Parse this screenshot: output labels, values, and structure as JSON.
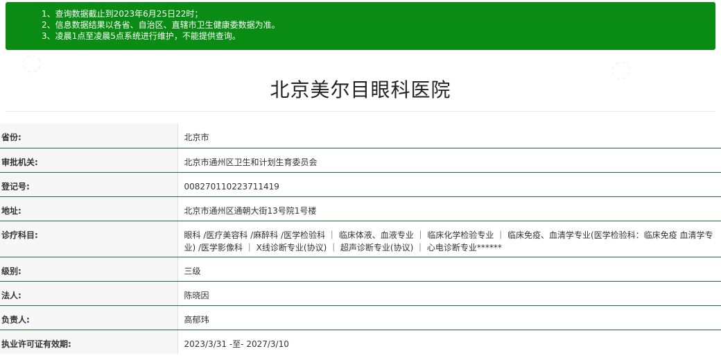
{
  "notice": {
    "lines": [
      "1、查询数据截止到2023年6月25日22时；",
      "2、信息数据结果以各省、自治区、直辖市卫生健康委数据为准。",
      "3、凌晨1点至凌晨5点系统进行维护，不能提供查询。"
    ]
  },
  "page_title": "北京美尔目眼科医院",
  "rows": [
    {
      "label": "省份:",
      "value": "北京市"
    },
    {
      "label": "审批机关:",
      "value": "北京市通州区卫生和计划生育委员会"
    },
    {
      "label": "登记号:",
      "value": "008270110223711419"
    },
    {
      "label": "地址:",
      "value": "北京市通州区通朝大街13号院1号楼"
    },
    {
      "label": "诊疗科目:",
      "value": "眼科 /医疗美容科 /麻醉科 /医学检验科 ｜ 临床体液、血液专业 ｜ 临床化学检验专业 ｜ 临床免疫、血清学专业(医学检验科：临床免疫 血清学专业) /医学影像科 ｜ X线诊断专业(协议) ｜ 超声诊断专业(协议) ｜ 心电诊断专业******"
    },
    {
      "label": "级别:",
      "value": "三级"
    },
    {
      "label": "法人:",
      "value": "陈晓因"
    },
    {
      "label": "负责人:",
      "value": "高郁玮"
    },
    {
      "label": "执业许可证有效期:",
      "value": "2023/3/31 -至- 2027/3/10"
    }
  ],
  "colors": {
    "notice_bg": "#0a8c14",
    "label_bg": "#f7f7f7",
    "row_border": "#1f6b3a"
  }
}
